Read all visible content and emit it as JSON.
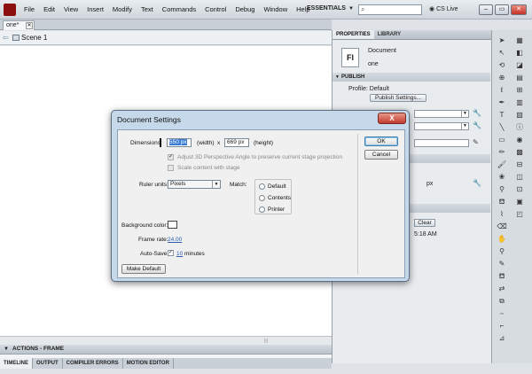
{
  "menubar": {
    "items": [
      "File",
      "Edit",
      "View",
      "Insert",
      "Modify",
      "Text",
      "Commands",
      "Control",
      "Debug",
      "Window",
      "Help"
    ],
    "workspace": "ESSENTIALS",
    "search_placeholder": "",
    "cslive": "CS Live"
  },
  "document": {
    "tab_label": "one*",
    "scene_label": "Scene 1"
  },
  "timeline": {
    "actions_label": "ACTIONS - FRAME",
    "tabs": [
      "TIMELINE",
      "OUTPUT",
      "COMPILER ERRORS",
      "MOTION EDITOR"
    ]
  },
  "properties": {
    "tabs": [
      "PROPERTIES",
      "LIBRARY"
    ],
    "doc_type": "Document",
    "doc_name": "one",
    "icon_text": "Fl",
    "publish_header": "PUBLISH",
    "profile_label": "Profile:",
    "profile_value": "Default",
    "publish_settings": "Publish Settings...",
    "px_label": "px",
    "clear_label": "Clear",
    "time_label": "5:18 AM"
  },
  "dialog": {
    "title": "Document Settings",
    "close_label": "X",
    "dimensions_label": "Dimensions:",
    "width_value": "550 px",
    "width_suffix": "(width)",
    "x_sep": "x",
    "height_value": "669 px",
    "height_suffix": "(height)",
    "adjust_3d_label": "Adjust 3D Perspective Angle to preserve current stage projection",
    "scale_label": "Scale content with stage",
    "ruler_label": "Ruler units:",
    "ruler_value": "Pixels",
    "match_label": "Match:",
    "match_options": [
      "Default",
      "Contents",
      "Printer"
    ],
    "bg_color_label": "Background color:",
    "bg_color": "#ffffff",
    "frame_rate_label": "Frame rate:",
    "frame_rate_value": "24.00",
    "autosave_label": "Auto-Save:",
    "autosave_value": "10",
    "autosave_unit": "minutes",
    "make_default": "Make Default",
    "ok": "OK",
    "cancel": "Cancel"
  }
}
